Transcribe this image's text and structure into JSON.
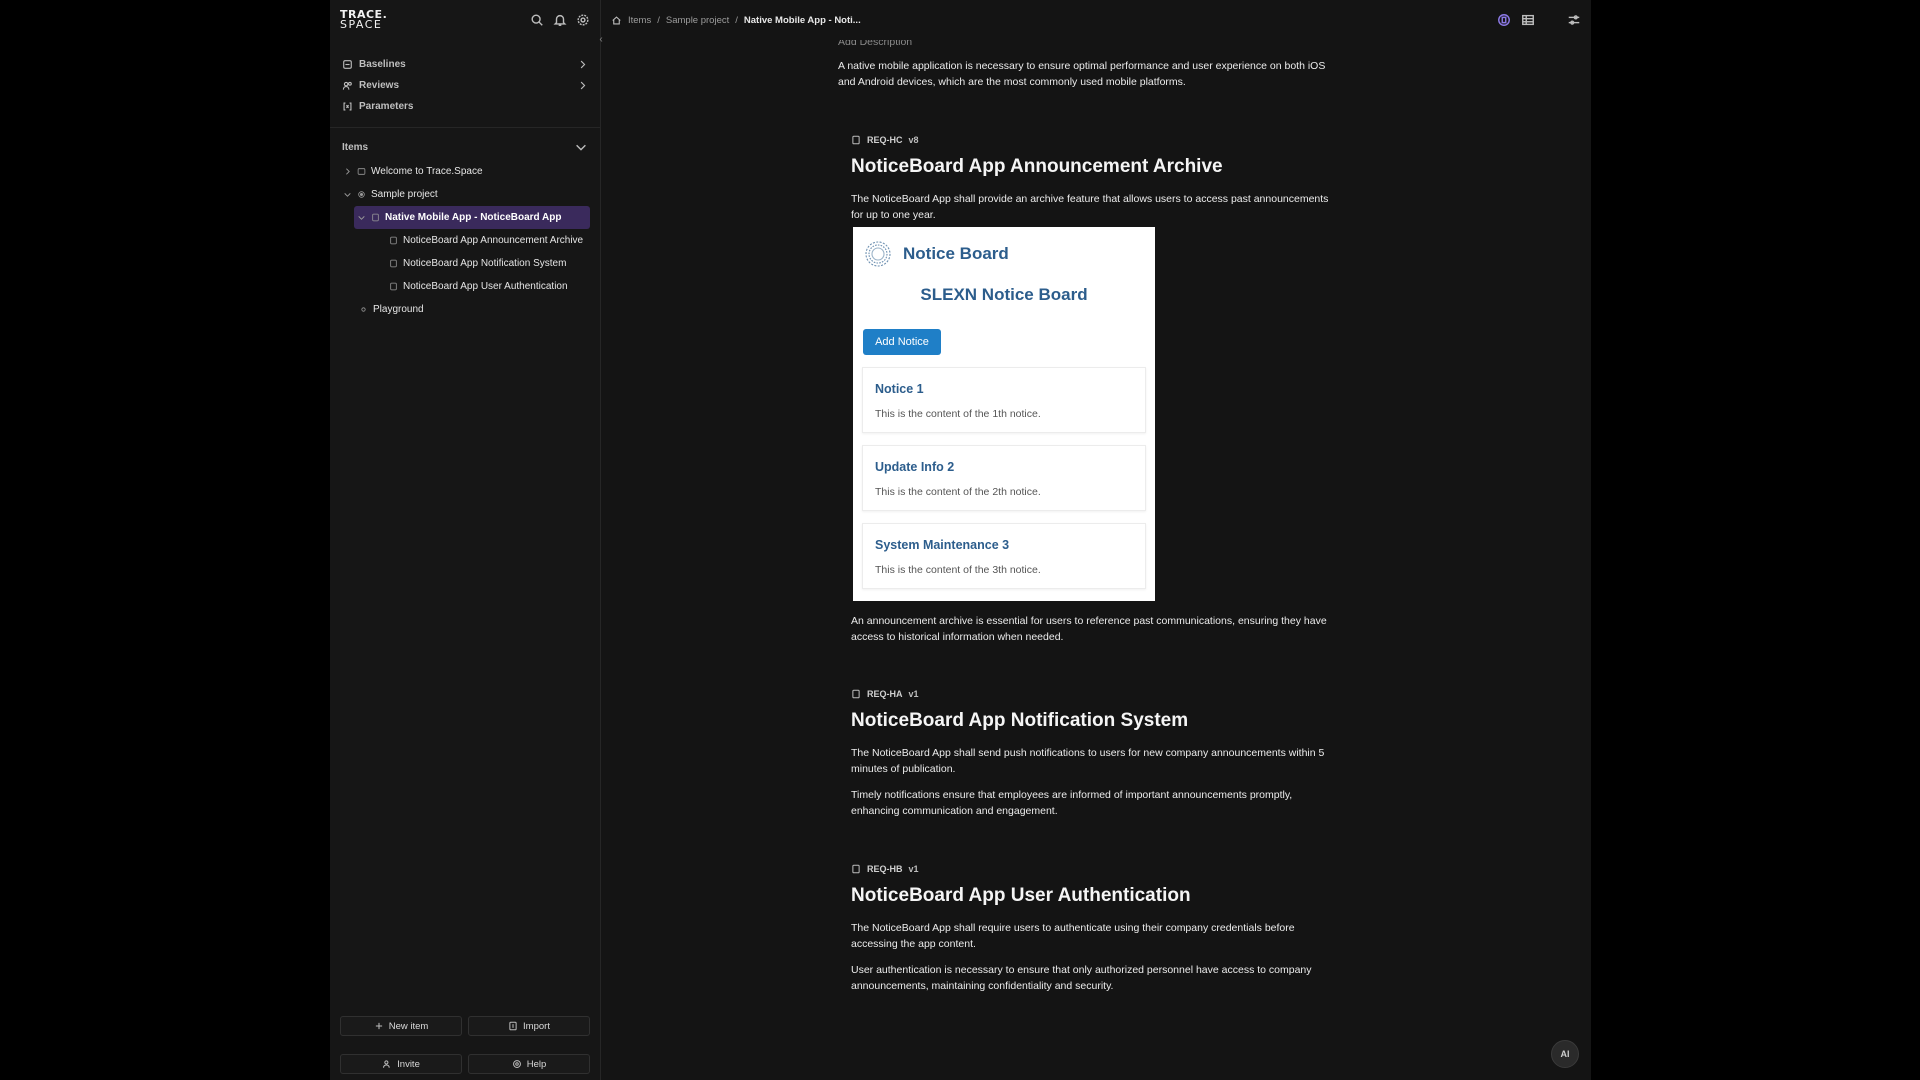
{
  "app": {
    "logo_line1": "TRACE.",
    "logo_line2": "SPACE"
  },
  "sidebar": {
    "menu": [
      {
        "label": "Baselines",
        "icon": "baseline-icon"
      },
      {
        "label": "Reviews",
        "icon": "review-icon"
      },
      {
        "label": "Parameters",
        "icon": "parameters-icon"
      }
    ],
    "items_heading": "Items",
    "tree": [
      {
        "label": "Welcome to Trace.Space"
      },
      {
        "label": "Sample project"
      },
      {
        "label": "Native Mobile App - NoticeBoard App"
      },
      {
        "label": "NoticeBoard App Announcement Archive"
      },
      {
        "label": "NoticeBoard App Notification System"
      },
      {
        "label": "NoticeBoard App User Authentication"
      },
      {
        "label": "Playground"
      }
    ],
    "buttons": {
      "new_item": "New item",
      "import": "Import",
      "invite": "Invite",
      "help": "Help"
    }
  },
  "breadcrumb": {
    "items": "Items",
    "project": "Sample project",
    "current": "Native Mobile App - Noti..."
  },
  "doc": {
    "ghost": "Add Description",
    "intro": "A native mobile application is necessary to ensure optimal performance and user experience on both iOS and Android devices, which are the most commonly used mobile platforms.",
    "requirements": [
      {
        "id": "REQ-HC",
        "version": "v8",
        "title": "NoticeBoard App Announcement Archive",
        "statement": "The NoticeBoard App shall provide an archive feature that allows users to access past announcements for up to one year.",
        "rationale": "An announcement archive is essential for users to reference past communications, ensuring they have access to historical information when needed."
      },
      {
        "id": "REQ-HA",
        "version": "v1",
        "title": "NoticeBoard App Notification System",
        "statement": "The NoticeBoard App shall send push notifications to users for new company announcements within 5 minutes of publication.",
        "rationale": "Timely notifications ensure that employees are informed of important announcements promptly, enhancing communication and engagement."
      },
      {
        "id": "REQ-HB",
        "version": "v1",
        "title": "NoticeBoard App User Authentication",
        "statement": "The NoticeBoard App shall require users to authenticate using their company credentials before accessing the app content.",
        "rationale": "User authentication is necessary to ensure that only authorized personnel have access to company announcements, maintaining confidentiality and security."
      }
    ],
    "notice_board_image": {
      "header": "Notice Board",
      "title": "SLEXN Notice Board",
      "add_button": "Add Notice",
      "cards": [
        {
          "title": "Notice 1",
          "text": "This is the content of the 1th notice."
        },
        {
          "title": "Update Info 2",
          "text": "This is the content of the 2th notice."
        },
        {
          "title": "System Maintenance 3",
          "text": "This is the content of the 3th notice."
        }
      ]
    }
  },
  "ai_button": "AI",
  "colors": {
    "accent": "#8c79e6",
    "active_row": "#3a2a5c",
    "notice_blue": "#2c5d8c",
    "add_button": "#1f7fc7"
  }
}
